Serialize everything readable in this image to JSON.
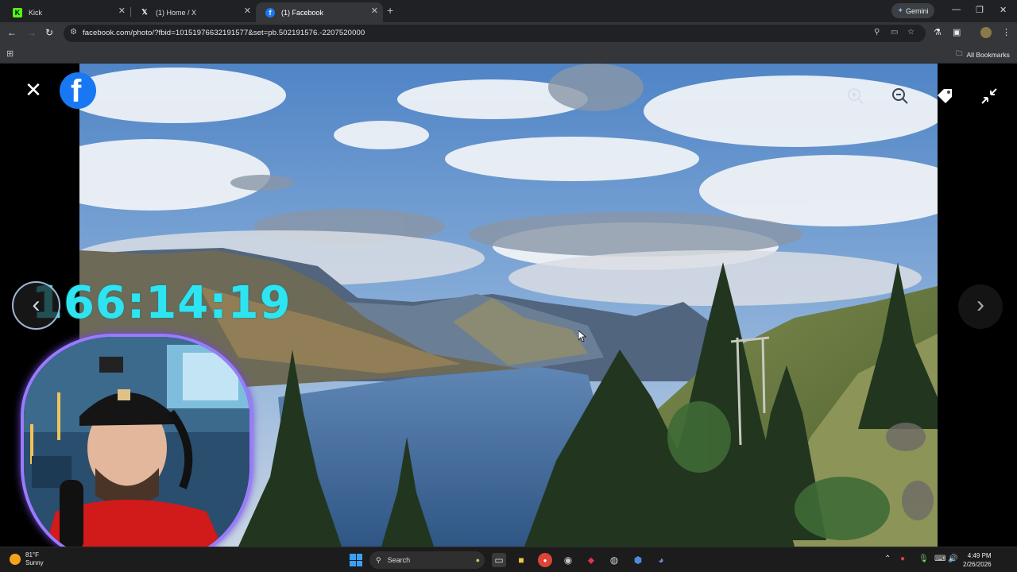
{
  "browser": {
    "tabs": [
      {
        "label": "Kick",
        "icon": "kick-icon",
        "active": false
      },
      {
        "label": "(1) Home / X",
        "icon": "x-icon",
        "active": false
      },
      {
        "label": "(1) Facebook",
        "icon": "facebook-icon",
        "active": true
      }
    ],
    "gemini_label": "Gemini",
    "url": "facebook.com/photo/?fbid=10151976632191577&set=pb.502191576.-2207520000",
    "all_bookmarks_label": "All Bookmarks"
  },
  "viewer": {
    "logo": "f",
    "close_glyph": "✕",
    "prev_glyph": "‹",
    "next_glyph": "›"
  },
  "overlay": {
    "timer": "166:14:19"
  },
  "taskbar": {
    "weather_temp": "81°F",
    "weather_cond": "Sunny",
    "search_label": "Search",
    "time": "4:49 PM",
    "date": "2/26/2026"
  },
  "colors": {
    "facebook_blue": "#1877f2",
    "timer_cyan": "#2ee4f0",
    "webcam_border": "#9a7bff"
  }
}
